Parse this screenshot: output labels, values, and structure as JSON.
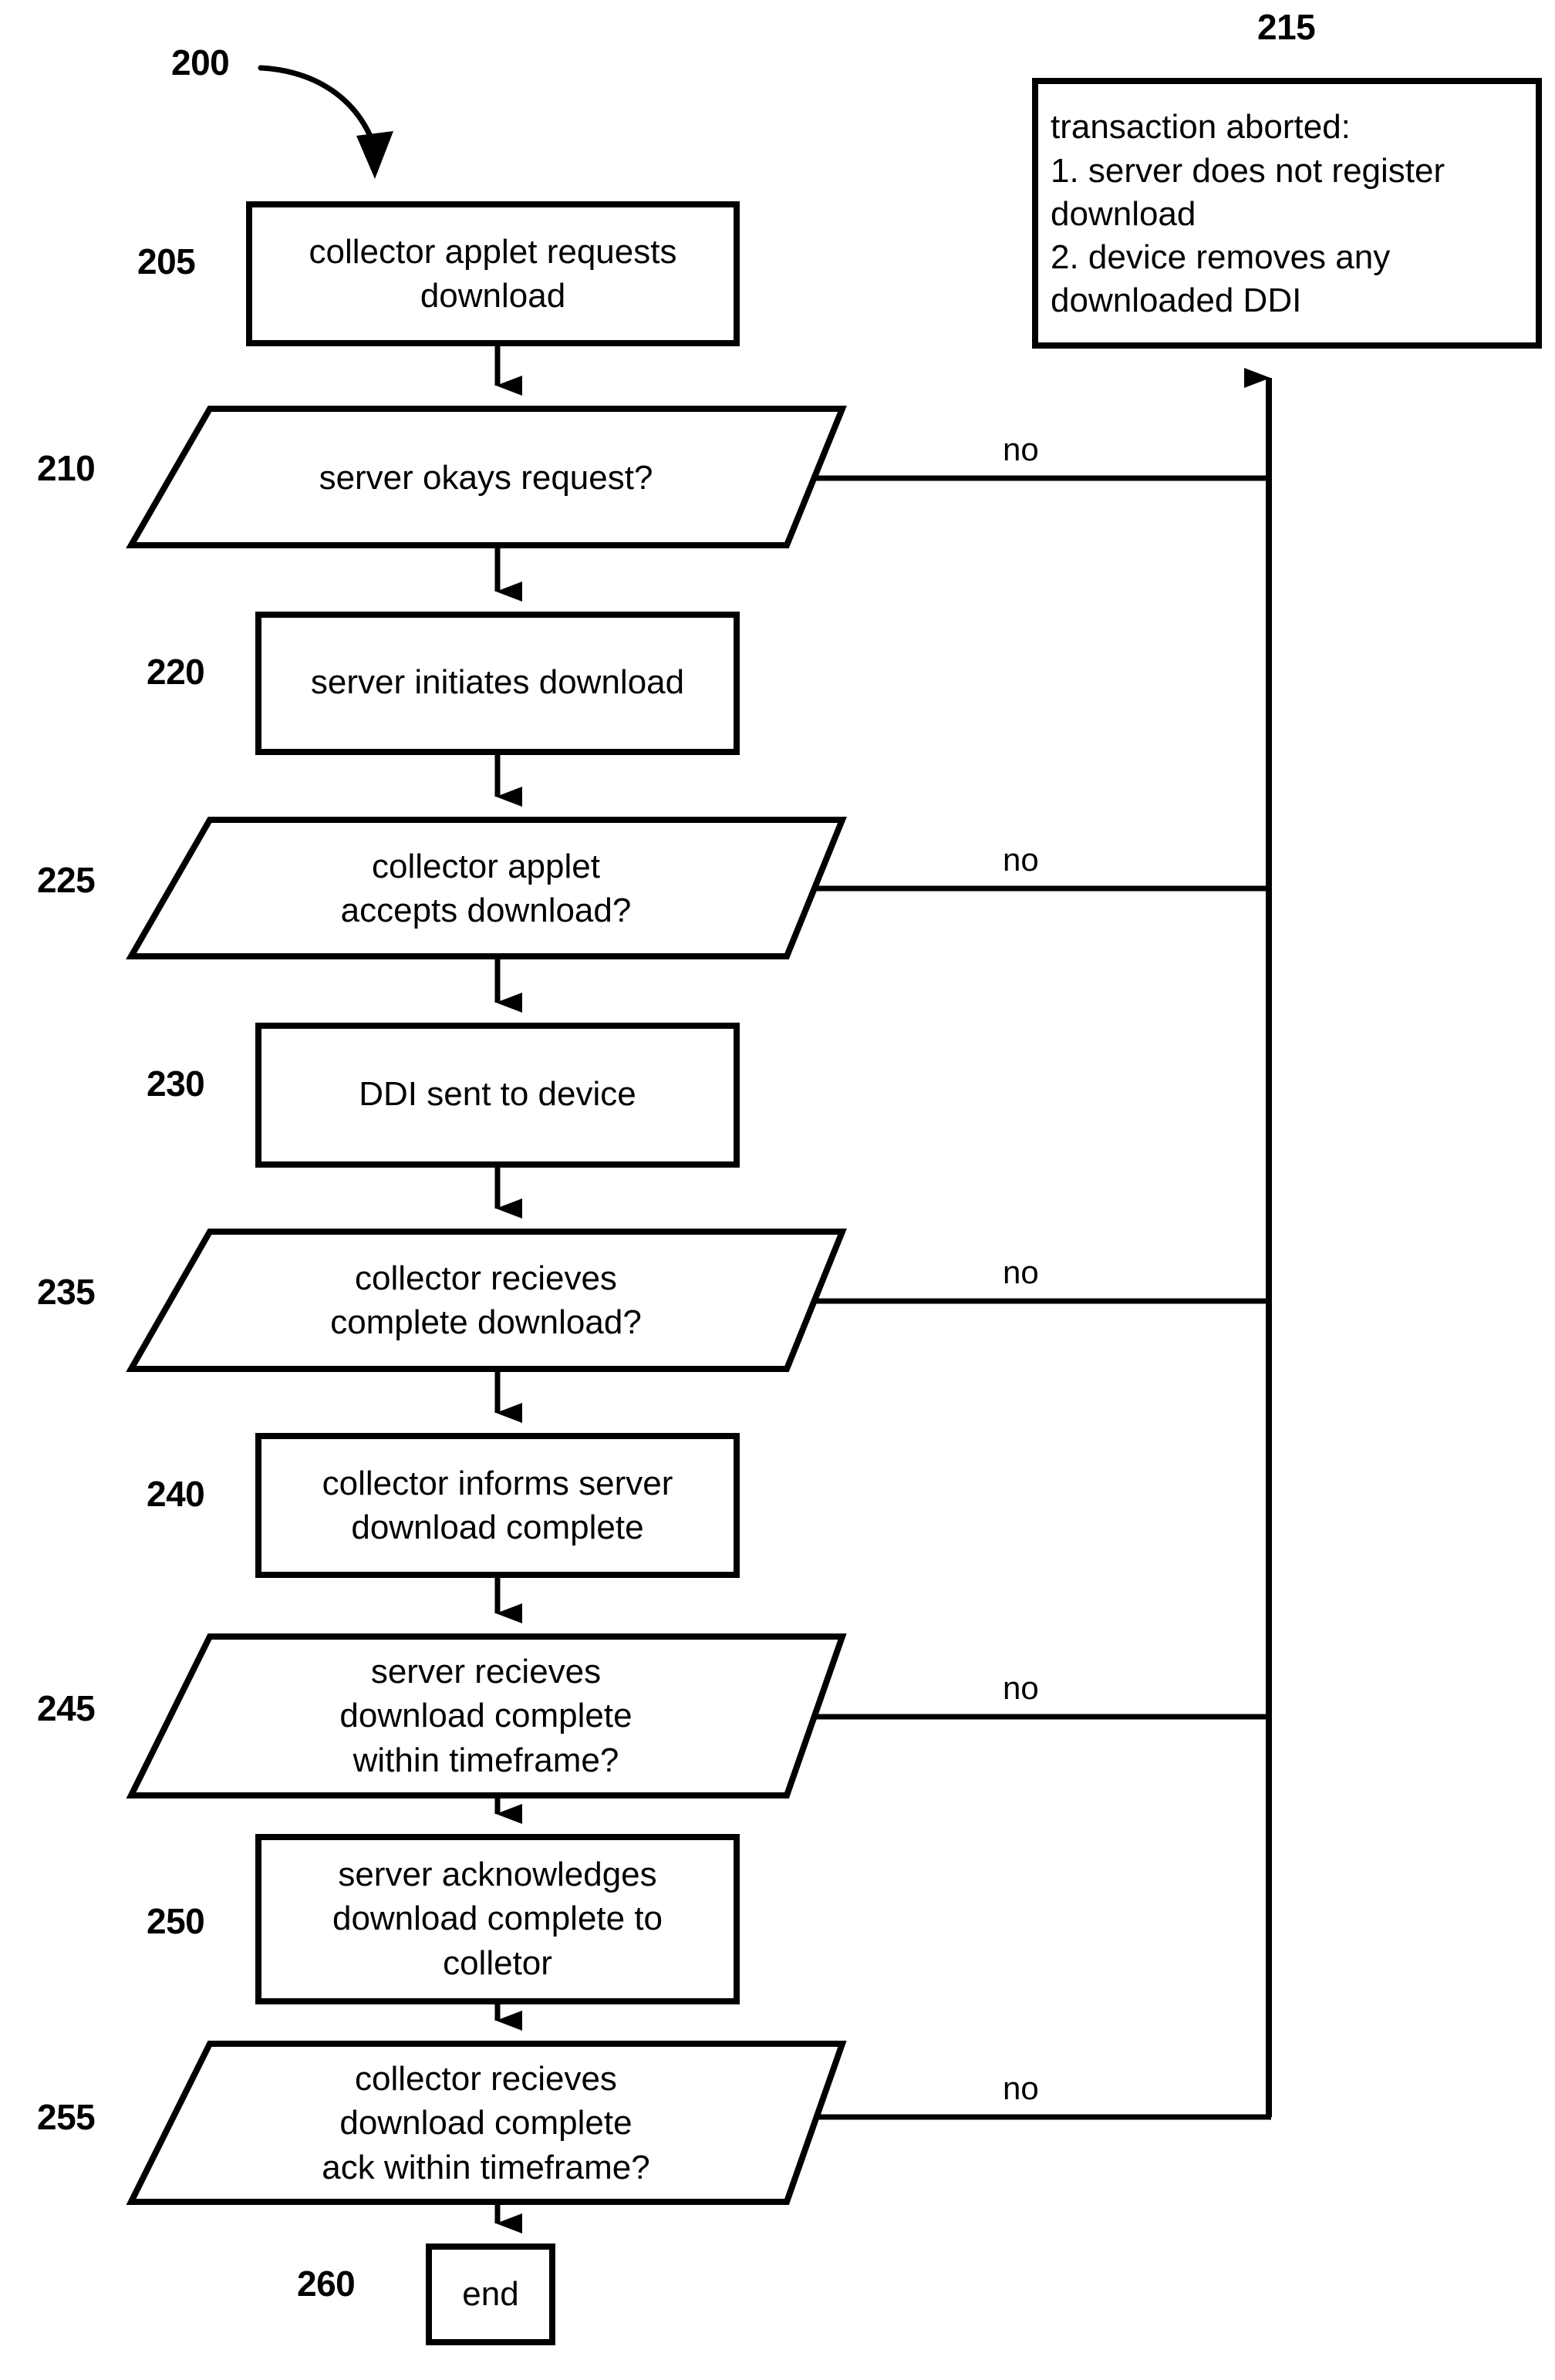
{
  "figure": {
    "ref_number": "200",
    "no_label": "no",
    "decision_no_labels": [
      "no",
      "no",
      "no",
      "no",
      "no"
    ]
  },
  "nodes": [
    {
      "id": "205",
      "ref": "205",
      "shape": "rectangle",
      "text": "collector applet requests\ndownload"
    },
    {
      "id": "210",
      "ref": "210",
      "shape": "parallelogram",
      "text": "server okays request?"
    },
    {
      "id": "215",
      "ref": "215",
      "shape": "rectangle",
      "text": "transaction aborted:\n1. server does not register\ndownload\n2. device removes any\ndownloaded DDI"
    },
    {
      "id": "220",
      "ref": "220",
      "shape": "rectangle",
      "text": "server initiates download"
    },
    {
      "id": "225",
      "ref": "225",
      "shape": "parallelogram",
      "text": "collector applet\naccepts download?"
    },
    {
      "id": "230",
      "ref": "230",
      "shape": "rectangle",
      "text": "DDI sent to device"
    },
    {
      "id": "235",
      "ref": "235",
      "shape": "parallelogram",
      "text": "collector recieves\ncomplete download?"
    },
    {
      "id": "240",
      "ref": "240",
      "shape": "rectangle",
      "text": "collector informs server\ndownload complete"
    },
    {
      "id": "245",
      "ref": "245",
      "shape": "parallelogram",
      "text": "server recieves\ndownload complete\nwithin timeframe?"
    },
    {
      "id": "250",
      "ref": "250",
      "shape": "rectangle",
      "text": "server acknowledges\ndownload complete to\ncolletor"
    },
    {
      "id": "255",
      "ref": "255",
      "shape": "parallelogram",
      "text": "collector recieves\ndownload complete\nack within timeframe?"
    },
    {
      "id": "260",
      "ref": "260",
      "shape": "rectangle",
      "text": "end"
    }
  ]
}
